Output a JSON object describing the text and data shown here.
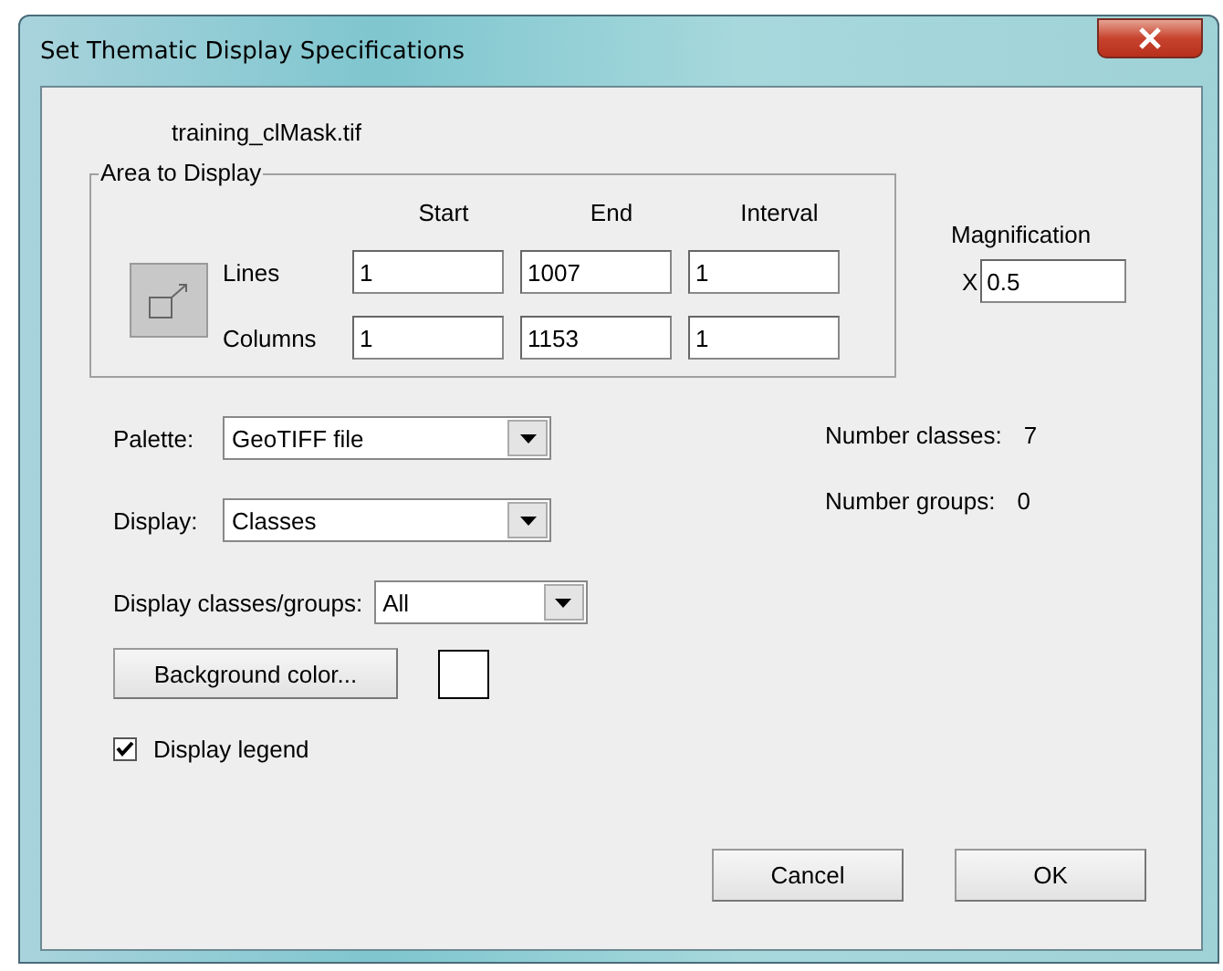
{
  "window": {
    "title": "Set Thematic Display Specifications"
  },
  "file_name": "training_clMask.tif",
  "area_to_display": {
    "title": "Area to Display",
    "column_headers": [
      "Start",
      "End",
      "Interval"
    ],
    "rows": [
      {
        "label": "Lines",
        "values": [
          "1",
          "1007",
          "1"
        ]
      },
      {
        "label": "Columns",
        "values": [
          "1",
          "1153",
          "1"
        ]
      }
    ]
  },
  "magnification": {
    "label": "Magnification",
    "prefix": "X",
    "value": "0.5"
  },
  "dropdowns": [
    {
      "label": "Palette:",
      "value": "GeoTIFF file"
    },
    {
      "label": "Display:",
      "value": "Classes"
    },
    {
      "label": "Display classes/groups:",
      "value": "All"
    }
  ],
  "background_color": {
    "button": "Background color...",
    "color": "#ffffff"
  },
  "display_legend": {
    "label": "Display legend",
    "checked": true
  },
  "stats": [
    {
      "label": "Number classes:",
      "value": "7"
    },
    {
      "label": "Number groups:",
      "value": "0"
    }
  ],
  "buttons": [
    "Cancel",
    "OK"
  ]
}
